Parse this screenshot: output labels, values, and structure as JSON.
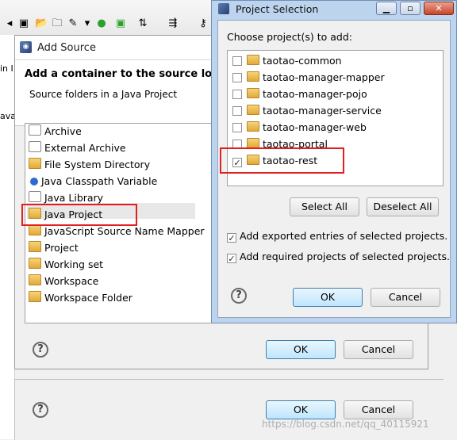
{
  "left_panel": {
    "fragments": [
      "in I",
      "ava"
    ]
  },
  "add_source": {
    "title": "Add Source",
    "heading": "Add a container to the source lookup p",
    "subheading": "Source folders in a Java Project",
    "items": [
      {
        "label": "Archive",
        "icon": "jar-icon"
      },
      {
        "label": "External Archive",
        "icon": "jar-icon"
      },
      {
        "label": "File System Directory",
        "icon": "folder-icon"
      },
      {
        "label": "Java Classpath Variable",
        "icon": "variable-dot-icon"
      },
      {
        "label": "Java Library",
        "icon": "library-icon"
      },
      {
        "label": "Java Project",
        "icon": "folder-icon"
      },
      {
        "label": "JavaScript Source Name Mapper",
        "icon": "mapper-icon"
      },
      {
        "label": "Project",
        "icon": "folder-icon"
      },
      {
        "label": "Working set",
        "icon": "folder-icon"
      },
      {
        "label": "Workspace",
        "icon": "folder-icon"
      },
      {
        "label": "Workspace Folder",
        "icon": "folder-icon"
      }
    ],
    "ok_label": "OK",
    "cancel_label": "Cancel"
  },
  "back_dialog": {
    "ok_label": "OK",
    "cancel_label": "Cancel"
  },
  "project_selection": {
    "title": "Project Selection",
    "label": "Choose project(s) to add:",
    "projects": [
      {
        "name": "taotao-common",
        "checked": false
      },
      {
        "name": "taotao-manager-mapper",
        "checked": false
      },
      {
        "name": "taotao-manager-pojo",
        "checked": false
      },
      {
        "name": "taotao-manager-service",
        "checked": false
      },
      {
        "name": "taotao-manager-web",
        "checked": false
      },
      {
        "name": "taotao-portal",
        "checked": false
      },
      {
        "name": "taotao-rest",
        "checked": true
      }
    ],
    "select_all_label": "Select All",
    "deselect_all_label": "Deselect All",
    "options": [
      {
        "label": "Add exported entries of selected projects.",
        "checked": true
      },
      {
        "label": "Add required projects of selected projects.",
        "checked": true
      }
    ],
    "ok_label": "OK",
    "cancel_label": "Cancel"
  },
  "watermark": "https://blog.csdn.net/qq_40115921",
  "colors": {
    "highlight_box": "#e02020",
    "title_bar": "#bcd4ee"
  }
}
